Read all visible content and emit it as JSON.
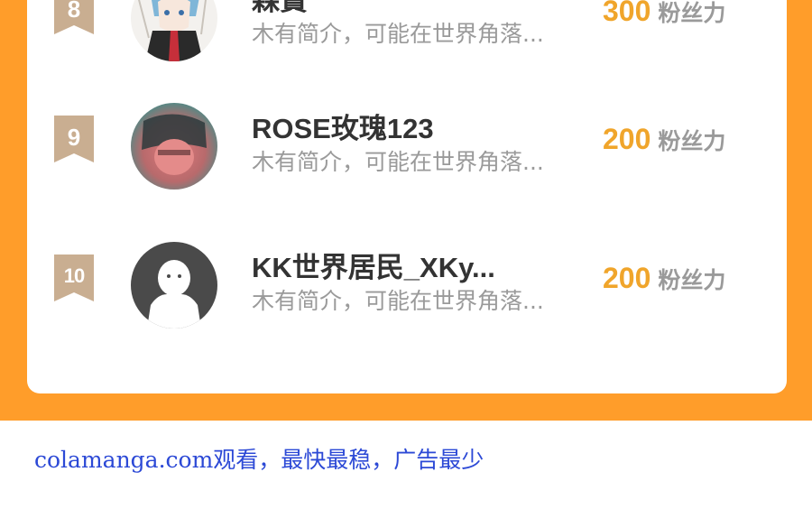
{
  "colors": {
    "frame": "#ff9d2a",
    "badge": "#c9ae91",
    "score": "#f0a52b",
    "link": "#2c49d6"
  },
  "ranking": [
    {
      "rank": "8",
      "name": "森寶",
      "desc": "木有简介，可能在世界角落...",
      "score": "300",
      "unit": "粉丝力",
      "avatar_icon": "anime-character-avatar"
    },
    {
      "rank": "9",
      "name": "ROSE玫瑰123",
      "desc": "木有简介，可能在世界角落...",
      "score": "200",
      "unit": "粉丝力",
      "avatar_icon": "photo-avatar"
    },
    {
      "rank": "10",
      "name": "KK世界居民_XKy...",
      "desc": "木有简介，可能在世界角落...",
      "score": "200",
      "unit": "粉丝力",
      "avatar_icon": "default-user-avatar"
    }
  ],
  "footer": {
    "text": "colamanga.com观看，最快最稳，广告最少"
  }
}
